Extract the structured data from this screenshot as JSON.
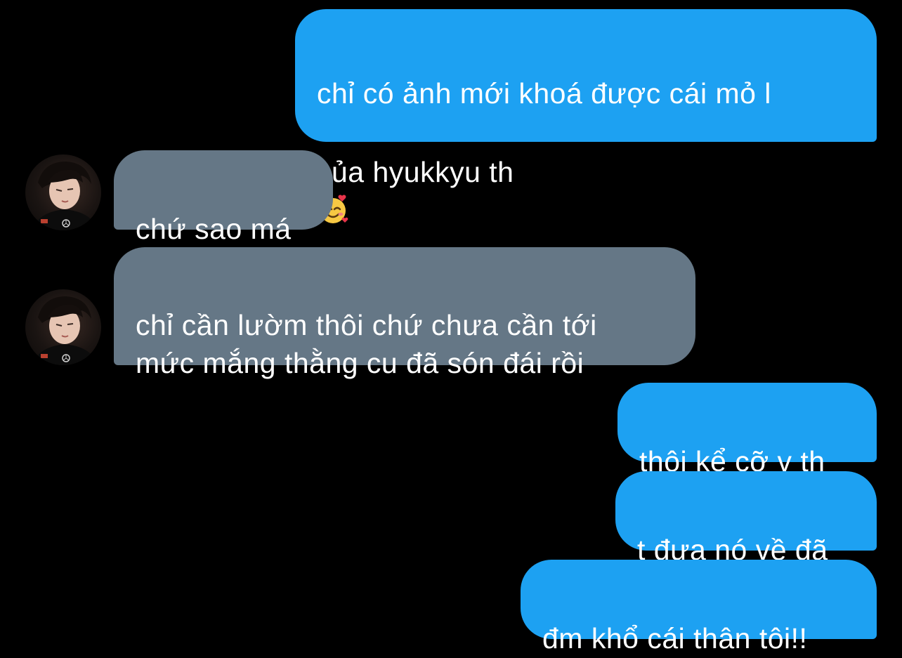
{
  "conversation": {
    "messages": [
      {
        "sender": "me",
        "text_line1": "chỉ có ảnh mới khoá được cái mỏ l",
        "text_line2": "của hyukkyu th",
        "emoji": "smiling-face-with-hearts-icon"
      },
      {
        "sender": "them",
        "text": "chứ sao má"
      },
      {
        "sender": "them",
        "text": "chỉ cần lườm thôi chứ chưa cần tới\nmức mắng thằng cu đã són đái rồi"
      },
      {
        "sender": "me",
        "text": "thôi kể cỡ v th"
      },
      {
        "sender": "me",
        "text": "t đưa nó về đã"
      },
      {
        "sender": "me",
        "text": "đm khổ cái thân tôi!!"
      }
    ]
  },
  "colors": {
    "background": "#000000",
    "sent_bubble": "#1da1f2",
    "received_bubble": "#657786",
    "text": "#ffffff"
  }
}
